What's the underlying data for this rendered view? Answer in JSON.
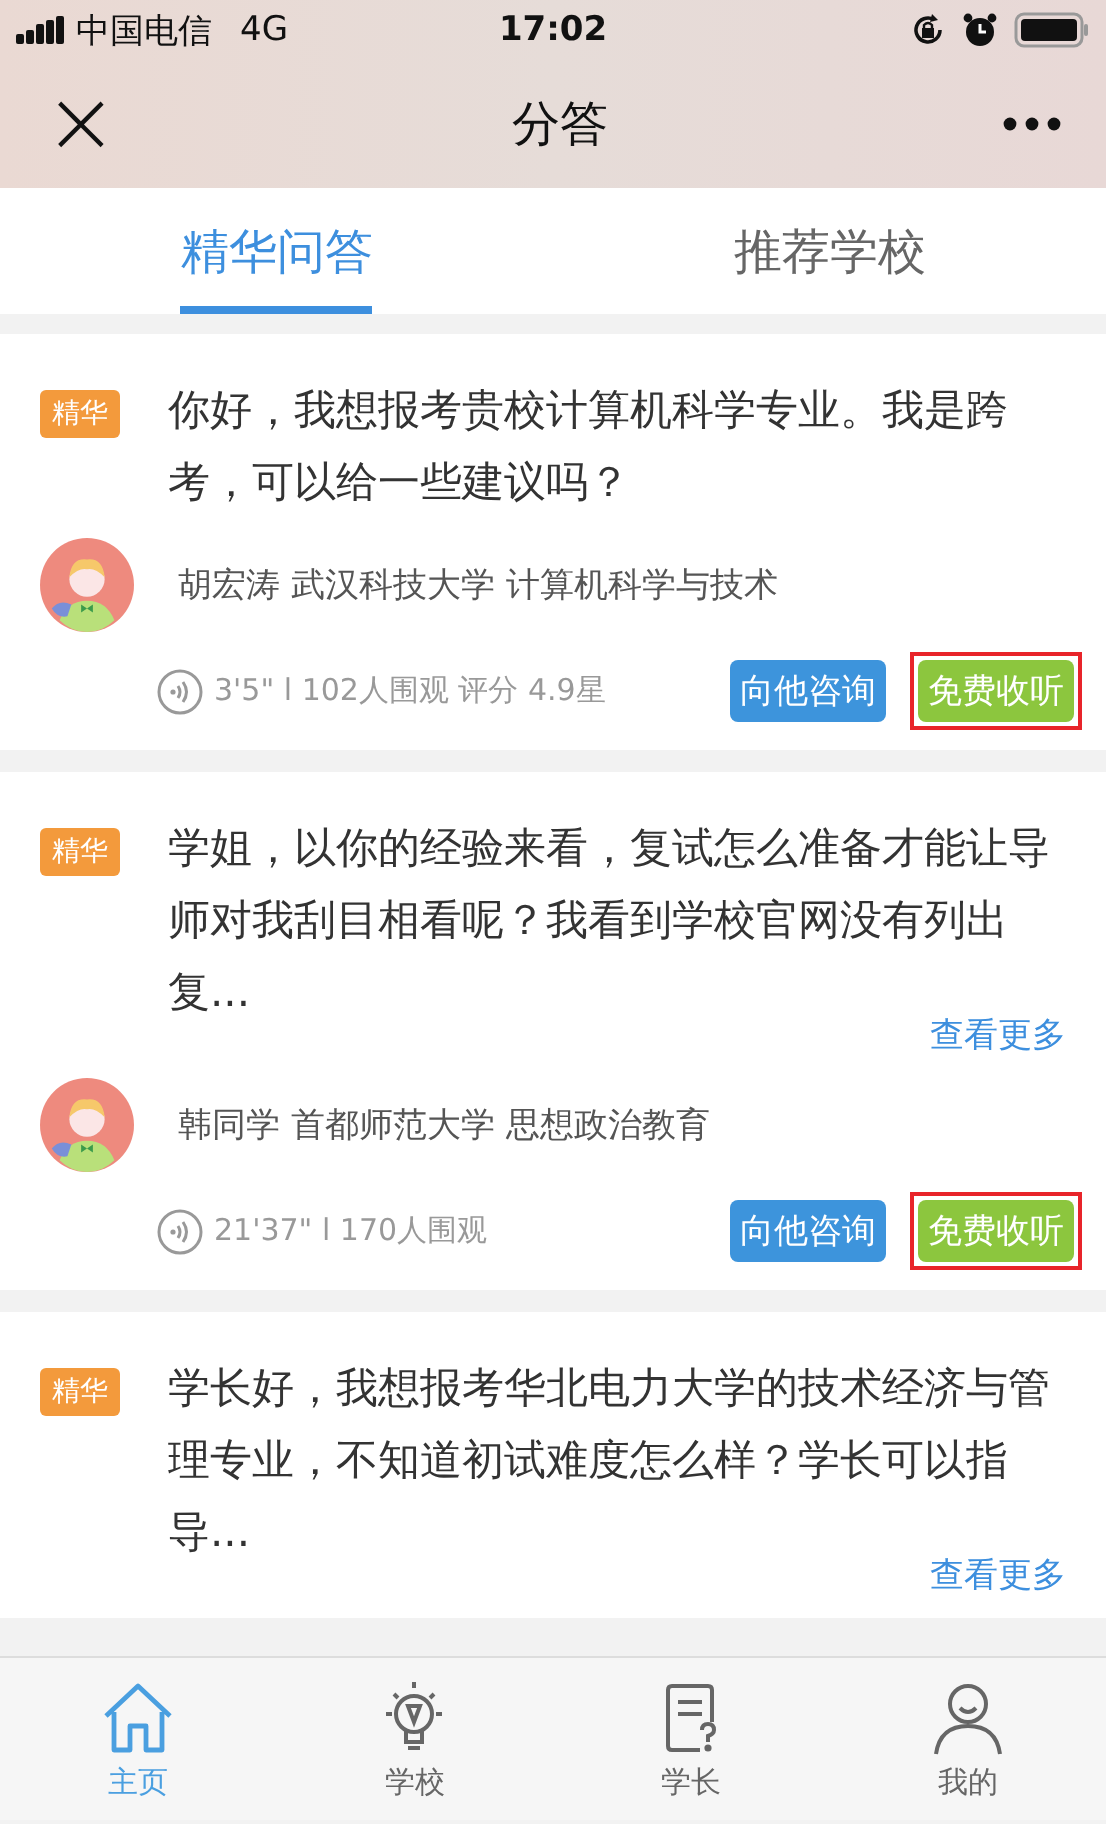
{
  "status_bar": {
    "carrier": "中国电信",
    "network": "4G",
    "time": "17:02"
  },
  "nav_bar": {
    "close": "×",
    "title": "分答"
  },
  "tabs": [
    {
      "label": "精华问答",
      "selected": true
    },
    {
      "label": "推荐学校",
      "selected": false
    }
  ],
  "questions": [
    {
      "badge": "精华",
      "text": "你好，我想报考贵校计算机科学专业。我是跨考，可以给一些建议吗？",
      "author": "胡宏涛 武汉科技大学 计算机科学与技术",
      "meta": "3'5\" l 102人围观 评分 4.9星",
      "consult_button": "向他咨询",
      "listen_button": "免费收听",
      "highlighted": true
    },
    {
      "badge": "精华",
      "text": "学姐，以你的经验来看，复试怎么准备才能让导师对我刮目相看呢？我看到学校官网没有列出复...",
      "more": "查看更多",
      "author": "韩同学 首都师范大学 思想政治教育",
      "meta": "21'37\" l 170人围观",
      "consult_button": "向他咨询",
      "listen_button": "免费收听",
      "highlighted": true
    },
    {
      "badge": "精华",
      "text": "学长好，我想报考华北电力大学的技术经济与管理专业，不知道初试难度怎么样？学长可以指导...",
      "more": "查看更多"
    }
  ],
  "bottom_nav": [
    {
      "label": "主页",
      "kind": "home",
      "selected": true
    },
    {
      "label": "学校",
      "kind": "bulb",
      "selected": false
    },
    {
      "label": "学长",
      "kind": "doc",
      "selected": false
    },
    {
      "label": "我的",
      "kind": "person",
      "selected": false
    }
  ]
}
